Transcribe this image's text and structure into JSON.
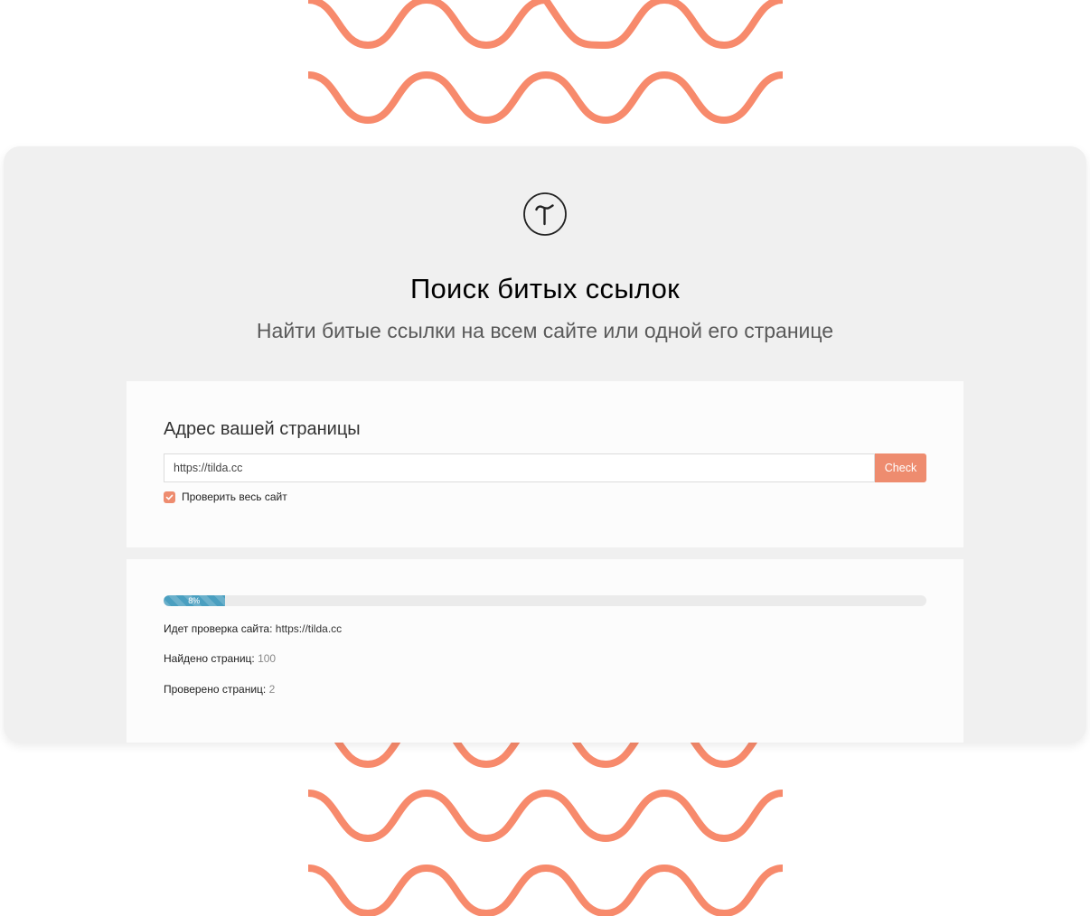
{
  "colors": {
    "accent": "#ee8c6f",
    "wave": "#f78a6c",
    "progress": "#4a9fc0",
    "card_bg": "#f0f0f0",
    "panel_bg": "#fcfcfc"
  },
  "header": {
    "logo_icon": "tilda-logo-icon",
    "title": "Поиск битых ссылок",
    "subtitle": "Найти битые ссылки на всем сайте или одной его странице"
  },
  "form": {
    "label": "Адрес вашей страницы",
    "url_value": "https://tilda.cc",
    "check_button": "Check",
    "checkbox_label": "Проверить весь сайт",
    "checkbox_checked": true
  },
  "progress": {
    "percent": 8,
    "label": "8%",
    "checking_label": "Идет проверка сайта:",
    "checking_url": "https://tilda.cc",
    "found_label": "Найдено страниц:",
    "found_value": "100",
    "checked_label": "Проверено страниц:",
    "checked_value": "2"
  }
}
